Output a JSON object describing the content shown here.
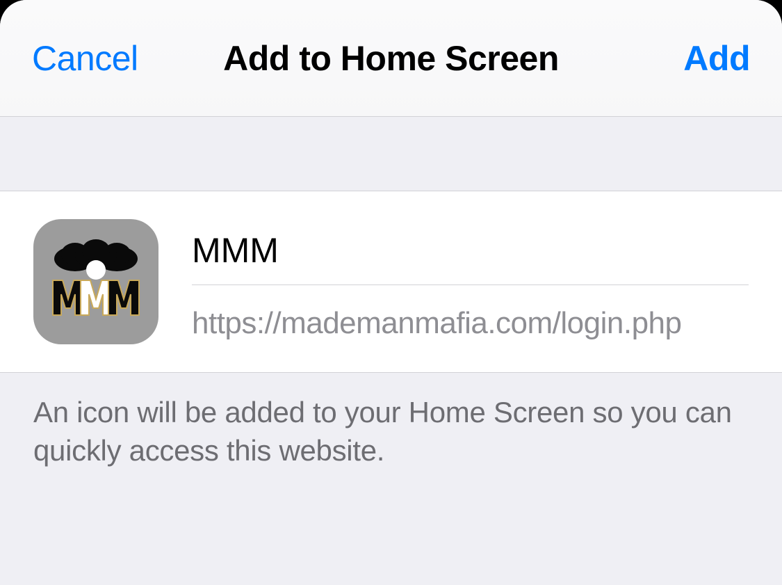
{
  "nav": {
    "cancel_label": "Cancel",
    "title": "Add to Home Screen",
    "add_label": "Add"
  },
  "content": {
    "app_name": "MMM",
    "url": "https://mademanmafia.com/login.php"
  },
  "footer": {
    "description": "An icon will be added to your Home Screen so you can quickly access this website."
  }
}
